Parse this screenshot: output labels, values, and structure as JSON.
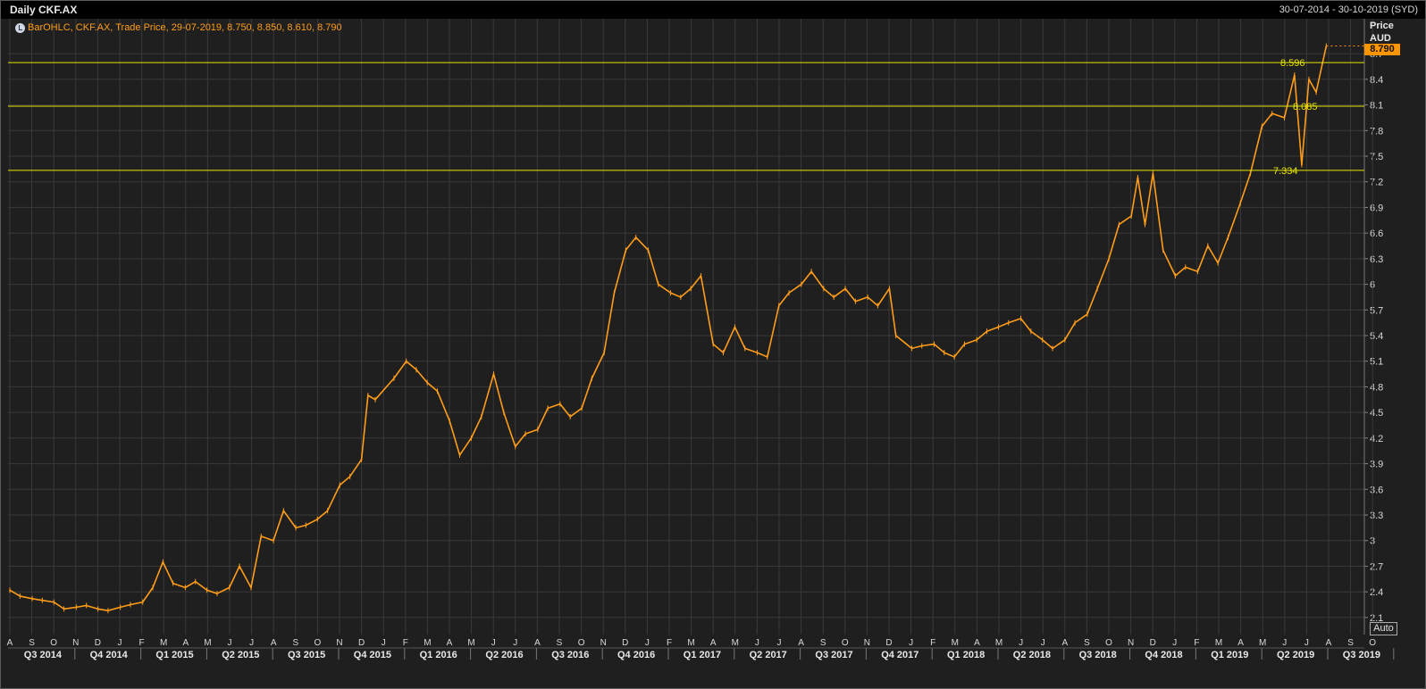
{
  "header": {
    "title": "Daily CKF.AX",
    "date_range": "30-07-2014 - 30-10-2019 (SYD)"
  },
  "legend": {
    "text": "BarOHLC, CKF.AX, Trade Price, 29-07-2019, 8.750, 8.850, 8.610, 8.790",
    "icon": "clock-icon"
  },
  "axis_panel": {
    "unit_label_1": "Price",
    "unit_label_2": "AUD",
    "last_value": "8.790",
    "auto_button": "Auto"
  },
  "colors": {
    "background": "#1f1f1f",
    "grid": "#3a3a3a",
    "series": "#ff9d1a",
    "hlines": "#e6e600",
    "last_badge": "#ff9500"
  },
  "chart_data": {
    "type": "line",
    "title": "Daily CKF.AX",
    "subtitle": "BarOHLC, CKF.AX, Trade Price, 29-07-2019, 8.750, 8.850, 8.610, 8.790",
    "xlabel": "",
    "ylabel": "Price AUD",
    "ylim": [
      1.9,
      8.9
    ],
    "grid": true,
    "y_ticks": [
      "2.1",
      "2.4",
      "2.7",
      "3",
      "3.3",
      "3.6",
      "3.9",
      "4.2",
      "4.5",
      "4.8",
      "5.1",
      "5.4",
      "5.7",
      "6",
      "6.3",
      "6.6",
      "6.9",
      "7.2",
      "7.5",
      "7.8",
      "8.1",
      "8.4",
      "8.7"
    ],
    "x_month_ticks": [
      "A",
      "S",
      "O",
      "N",
      "D",
      "J",
      "F",
      "M",
      "A",
      "M",
      "J",
      "J",
      "A",
      "S",
      "O",
      "N",
      "D",
      "J",
      "F",
      "M",
      "A",
      "M",
      "J",
      "J",
      "A",
      "S",
      "O",
      "N",
      "D",
      "J",
      "F",
      "M",
      "A",
      "M",
      "J",
      "J",
      "A",
      "S",
      "O",
      "N",
      "D",
      "J",
      "F",
      "M",
      "A",
      "M",
      "J",
      "J",
      "A",
      "S",
      "O",
      "N",
      "D",
      "J",
      "F",
      "M",
      "A",
      "M",
      "J",
      "J",
      "A",
      "S",
      "O"
    ],
    "x_quarter_ticks": [
      "Q3 2014",
      "Q4 2014",
      "Q1 2015",
      "Q2 2015",
      "Q3 2015",
      "Q4 2015",
      "Q1 2016",
      "Q2 2016",
      "Q3 2016",
      "Q4 2016",
      "Q1 2017",
      "Q2 2017",
      "Q3 2017",
      "Q4 2017",
      "Q1 2018",
      "Q2 2018",
      "Q3 2018",
      "Q4 2018",
      "Q1 2019",
      "Q2 2019",
      "Q3 2019"
    ],
    "horizontal_lines": [
      {
        "value": 8.596,
        "label": "8.596"
      },
      {
        "value": 8.085,
        "label": "8.085"
      },
      {
        "value": 7.334,
        "label": "7.334"
      }
    ],
    "series": [
      {
        "name": "CKF.AX",
        "points": [
          [
            "2014-08-01",
            2.42
          ],
          [
            "2014-08-15",
            2.35
          ],
          [
            "2014-09-01",
            2.32
          ],
          [
            "2014-09-15",
            2.3
          ],
          [
            "2014-10-01",
            2.28
          ],
          [
            "2014-10-15",
            2.2
          ],
          [
            "2014-11-01",
            2.22
          ],
          [
            "2014-11-15",
            2.24
          ],
          [
            "2014-12-01",
            2.2
          ],
          [
            "2014-12-15",
            2.18
          ],
          [
            "2015-01-01",
            2.22
          ],
          [
            "2015-01-15",
            2.25
          ],
          [
            "2015-02-01",
            2.28
          ],
          [
            "2015-02-15",
            2.45
          ],
          [
            "2015-03-01",
            2.75
          ],
          [
            "2015-03-15",
            2.5
          ],
          [
            "2015-04-01",
            2.45
          ],
          [
            "2015-04-15",
            2.52
          ],
          [
            "2015-05-01",
            2.42
          ],
          [
            "2015-05-15",
            2.38
          ],
          [
            "2015-06-01",
            2.45
          ],
          [
            "2015-06-15",
            2.7
          ],
          [
            "2015-07-01",
            2.45
          ],
          [
            "2015-07-15",
            3.05
          ],
          [
            "2015-08-01",
            3.0
          ],
          [
            "2015-08-15",
            3.35
          ],
          [
            "2015-09-01",
            3.15
          ],
          [
            "2015-09-15",
            3.18
          ],
          [
            "2015-10-01",
            3.25
          ],
          [
            "2015-10-15",
            3.35
          ],
          [
            "2015-11-01",
            3.65
          ],
          [
            "2015-11-15",
            3.75
          ],
          [
            "2015-12-01",
            3.95
          ],
          [
            "2015-12-10",
            4.7
          ],
          [
            "2015-12-20",
            4.65
          ],
          [
            "2016-01-15",
            4.9
          ],
          [
            "2016-02-01",
            5.1
          ],
          [
            "2016-02-15",
            5.0
          ],
          [
            "2016-03-01",
            4.85
          ],
          [
            "2016-03-15",
            4.75
          ],
          [
            "2016-04-01",
            4.4
          ],
          [
            "2016-04-15",
            4.0
          ],
          [
            "2016-05-01",
            4.2
          ],
          [
            "2016-05-15",
            4.45
          ],
          [
            "2016-06-01",
            4.95
          ],
          [
            "2016-06-15",
            4.5
          ],
          [
            "2016-07-01",
            4.1
          ],
          [
            "2016-07-15",
            4.25
          ],
          [
            "2016-08-01",
            4.3
          ],
          [
            "2016-08-15",
            4.55
          ],
          [
            "2016-09-01",
            4.6
          ],
          [
            "2016-09-15",
            4.45
          ],
          [
            "2016-10-01",
            4.55
          ],
          [
            "2016-10-15",
            4.9
          ],
          [
            "2016-11-01",
            5.2
          ],
          [
            "2016-11-15",
            5.9
          ],
          [
            "2016-12-01",
            6.4
          ],
          [
            "2016-12-15",
            6.55
          ],
          [
            "2017-01-01",
            6.4
          ],
          [
            "2017-01-15",
            6.0
          ],
          [
            "2017-02-01",
            5.9
          ],
          [
            "2017-02-15",
            5.85
          ],
          [
            "2017-03-01",
            5.95
          ],
          [
            "2017-03-15",
            6.1
          ],
          [
            "2017-04-01",
            5.3
          ],
          [
            "2017-04-15",
            5.2
          ],
          [
            "2017-05-01",
            5.5
          ],
          [
            "2017-05-15",
            5.25
          ],
          [
            "2017-06-01",
            5.2
          ],
          [
            "2017-06-15",
            5.15
          ],
          [
            "2017-07-01",
            5.75
          ],
          [
            "2017-07-15",
            5.9
          ],
          [
            "2017-08-01",
            6.0
          ],
          [
            "2017-08-15",
            6.15
          ],
          [
            "2017-09-01",
            5.95
          ],
          [
            "2017-09-15",
            5.85
          ],
          [
            "2017-10-01",
            5.95
          ],
          [
            "2017-10-15",
            5.8
          ],
          [
            "2017-11-01",
            5.85
          ],
          [
            "2017-11-15",
            5.75
          ],
          [
            "2017-12-01",
            5.95
          ],
          [
            "2017-12-10",
            5.4
          ],
          [
            "2018-01-01",
            5.25
          ],
          [
            "2018-01-15",
            5.28
          ],
          [
            "2018-02-01",
            5.3
          ],
          [
            "2018-02-15",
            5.2
          ],
          [
            "2018-03-01",
            5.15
          ],
          [
            "2018-03-15",
            5.3
          ],
          [
            "2018-04-01",
            5.35
          ],
          [
            "2018-04-15",
            5.45
          ],
          [
            "2018-05-01",
            5.5
          ],
          [
            "2018-05-15",
            5.55
          ],
          [
            "2018-06-01",
            5.6
          ],
          [
            "2018-06-15",
            5.45
          ],
          [
            "2018-07-01",
            5.35
          ],
          [
            "2018-07-15",
            5.25
          ],
          [
            "2018-08-01",
            5.35
          ],
          [
            "2018-08-15",
            5.55
          ],
          [
            "2018-09-01",
            5.65
          ],
          [
            "2018-09-15",
            5.95
          ],
          [
            "2018-10-01",
            6.3
          ],
          [
            "2018-10-15",
            6.7
          ],
          [
            "2018-11-01",
            6.8
          ],
          [
            "2018-11-10",
            7.25
          ],
          [
            "2018-11-20",
            6.7
          ],
          [
            "2018-12-01",
            7.3
          ],
          [
            "2018-12-15",
            6.4
          ],
          [
            "2019-01-01",
            6.1
          ],
          [
            "2019-01-15",
            6.2
          ],
          [
            "2019-02-01",
            6.15
          ],
          [
            "2019-02-15",
            6.45
          ],
          [
            "2019-03-01",
            6.25
          ],
          [
            "2019-03-15",
            6.55
          ],
          [
            "2019-04-01",
            6.95
          ],
          [
            "2019-04-15",
            7.3
          ],
          [
            "2019-05-01",
            7.85
          ],
          [
            "2019-05-15",
            8.0
          ],
          [
            "2019-06-01",
            7.95
          ],
          [
            "2019-06-15",
            8.45
          ],
          [
            "2019-06-25",
            7.4
          ],
          [
            "2019-07-05",
            8.4
          ],
          [
            "2019-07-15",
            8.25
          ],
          [
            "2019-07-29",
            8.79
          ]
        ]
      }
    ]
  }
}
